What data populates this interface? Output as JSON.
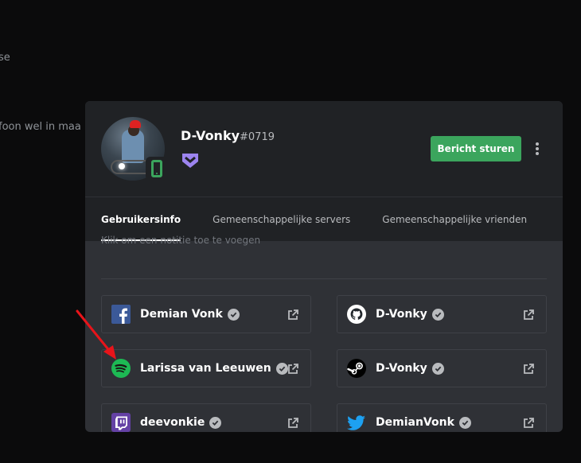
{
  "background": {
    "line1": "se",
    "line2": "foon wel in maa"
  },
  "profile": {
    "username": "D-Vonky",
    "discriminator": "#0719",
    "status_icon": "mobile-phone-icon",
    "badge_icon": "hypesquad-balance-icon",
    "badge_color": "#9c84ef"
  },
  "actions": {
    "send_message": "Bericht sturen",
    "more_icon": "more-vertical-icon"
  },
  "tabs": [
    {
      "label": "Gebruikersinfo",
      "active": true
    },
    {
      "label": "Gemeenschappelijke servers",
      "active": false
    },
    {
      "label": "Gemeenschappelijke vrienden",
      "active": false
    }
  ],
  "note": {
    "text": "Klik om een notitie toe te voegen"
  },
  "connections": [
    {
      "service": "facebook",
      "icon": "facebook-icon",
      "name": "Demian Vonk",
      "color": "#3b5998"
    },
    {
      "service": "github",
      "icon": "github-icon",
      "name": "D-Vonky",
      "color": "#ffffff"
    },
    {
      "service": "spotify",
      "icon": "spotify-icon",
      "name": "Larissa van Leeuwen",
      "color": "#1db954"
    },
    {
      "service": "steam",
      "icon": "steam-icon",
      "name": "D-Vonky",
      "color": "#000000"
    },
    {
      "service": "twitch",
      "icon": "twitch-icon",
      "name": "deevonkie",
      "color": "#6441a5"
    },
    {
      "service": "twitter",
      "icon": "twitter-icon",
      "name": "DemianVonk",
      "color": "#1da1f2"
    }
  ],
  "colors": {
    "accent_green": "#3ba55d",
    "modal_bg": "#2f3136",
    "header_bg": "#202225",
    "annotation_arrow": "#e8141a"
  }
}
